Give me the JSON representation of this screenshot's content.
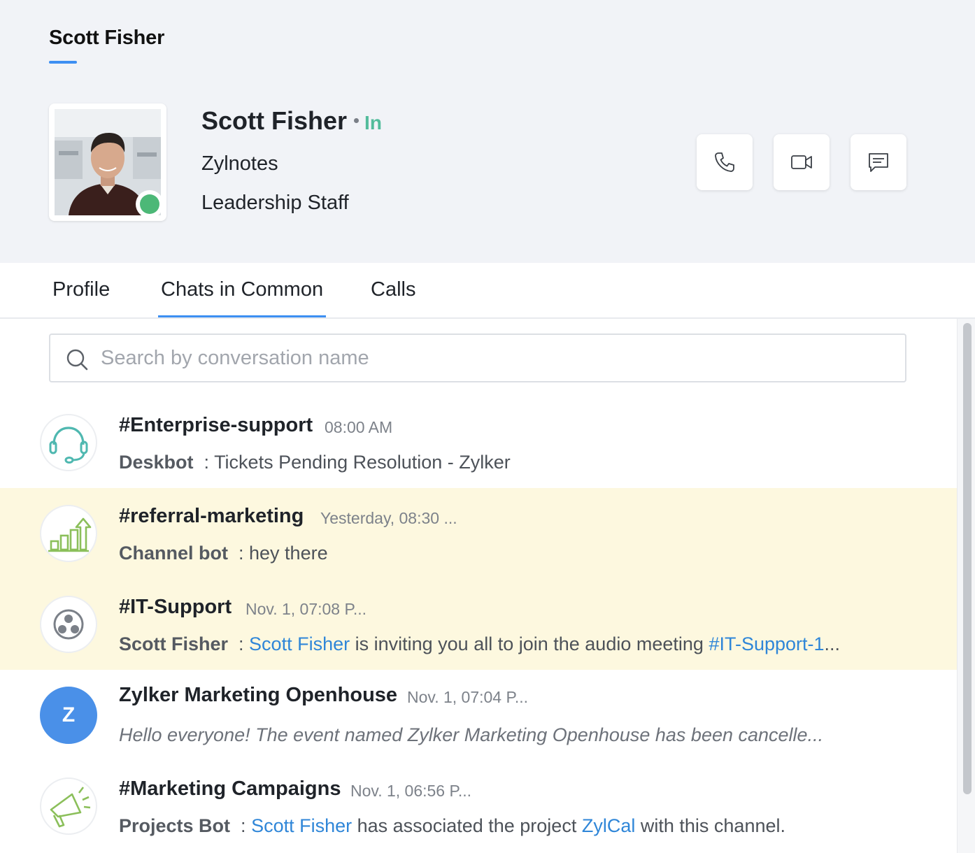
{
  "header": {
    "tab_title": "Scott Fisher"
  },
  "profile": {
    "name": "Scott Fisher",
    "status": "In",
    "organization": "Zylnotes",
    "role": "Leadership Staff",
    "presence_color": "#4cb877"
  },
  "actions": [
    {
      "name": "call-button",
      "icon": "phone-icon"
    },
    {
      "name": "video-call-button",
      "icon": "video-icon"
    },
    {
      "name": "message-button",
      "icon": "chat-icon"
    }
  ],
  "tabs": [
    {
      "label": "Profile",
      "active": false
    },
    {
      "label": "Chats in Common",
      "active": true
    },
    {
      "label": "Calls",
      "active": false
    }
  ],
  "search": {
    "placeholder": "Search by conversation name",
    "value": ""
  },
  "chats": [
    {
      "title": "#Enterprise-support",
      "time": "08:00 AM",
      "sender": "Deskbot",
      "message": "Tickets Pending Resolution - Zylker",
      "icon": "headset-icon",
      "highlighted": false
    },
    {
      "title": "#referral-marketing",
      "time": "Yesterday, 08:30 ...",
      "sender": "Channel bot",
      "message": "hey there",
      "icon": "growth-chart-icon",
      "highlighted": true
    },
    {
      "title": "#IT-Support",
      "time": "Nov. 1, 07:08 P...",
      "sender": "Scott Fisher",
      "message_link_1": "Scott Fisher",
      "message": "is inviting you all to join the audio meeting",
      "message_link_2": "#IT-Support-1",
      "message_tail": "...",
      "icon": "group-icon",
      "highlighted": true
    },
    {
      "title": "Zylker Marketing Openhouse",
      "time": "Nov. 1, 07:04 P...",
      "avatar_letter": "Z",
      "message": "Hello everyone! The event named Zylker Marketing Openhouse has been cancelle...",
      "highlighted": false
    },
    {
      "title": "#Marketing Campaigns",
      "time": "Nov. 1, 06:56 P...",
      "sender": "Projects Bot",
      "message_link_1": "Scott Fisher",
      "message": "has associated the project",
      "message_link_2": "ZylCal",
      "message_tail": "with this channel.",
      "icon": "megaphone-icon",
      "highlighted": false
    }
  ],
  "colors": {
    "accent": "#3d8ff2",
    "status_in": "#52bc9b",
    "link": "#2f86d8",
    "highlight_row": "#fdf8df",
    "letter_avatar": "#4a90e8"
  }
}
